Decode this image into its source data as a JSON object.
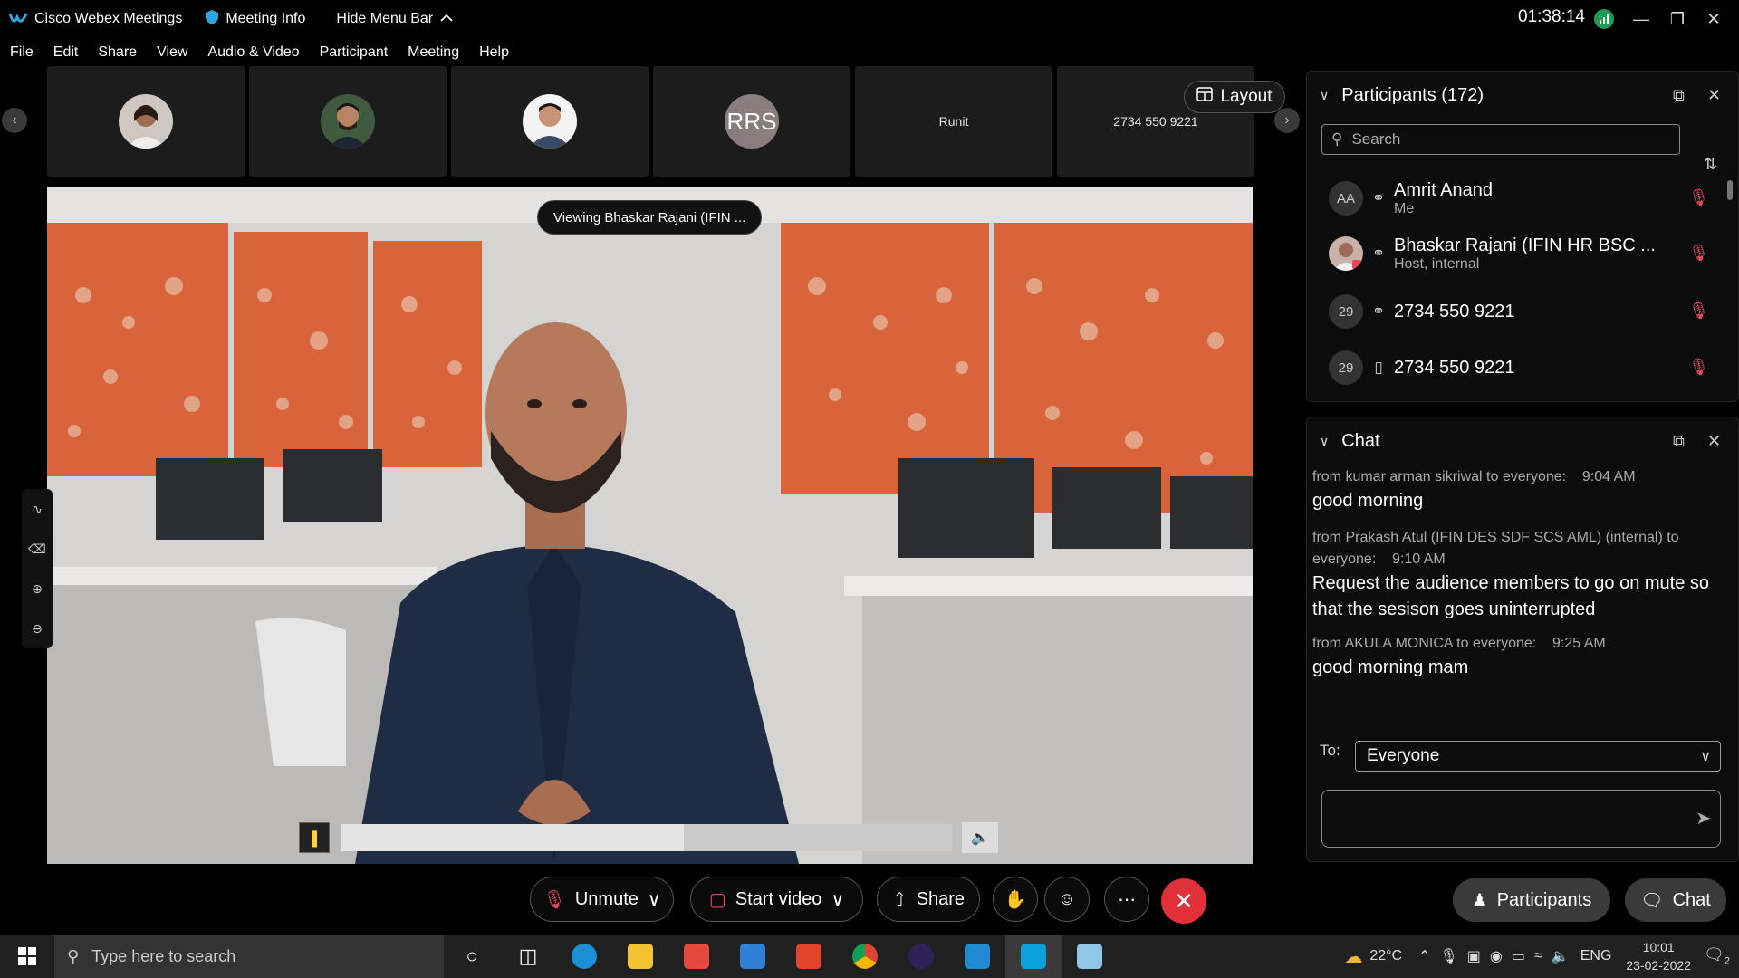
{
  "window": {
    "app_title": "Cisco Webex Meetings",
    "meeting_info": "Meeting Info",
    "hide_menu": "Hide Menu Bar",
    "timer": "01:38:14"
  },
  "menu": [
    "File",
    "Edit",
    "Share",
    "View",
    "Audio & Video",
    "Participant",
    "Meeting",
    "Help"
  ],
  "thumbnails": [
    {
      "type": "photo"
    },
    {
      "type": "photo"
    },
    {
      "type": "photo"
    },
    {
      "type": "initials",
      "label": "RRS"
    },
    {
      "type": "name",
      "label": "Runit"
    },
    {
      "type": "name",
      "label": "2734 550 9221"
    }
  ],
  "layout_label": "Layout",
  "stage": {
    "viewing_label": "Viewing Bhaskar Rajani (IFIN ...",
    "progress_fraction": 0.56
  },
  "participants": {
    "title": "Participants (172)",
    "search_placeholder": "Search",
    "list": [
      {
        "avatar": "AA",
        "name": "Amrit Anand",
        "sub": "Me",
        "conn": "headset"
      },
      {
        "avatar": "",
        "name": "Bhaskar Rajani (IFIN HR BSC ...",
        "sub": "Host, internal",
        "conn": "headset"
      },
      {
        "avatar": "29",
        "name": "2734 550 9221",
        "sub": "",
        "conn": "headset"
      },
      {
        "avatar": "29",
        "name": "2734 550 9221",
        "sub": "",
        "conn": "phone"
      }
    ]
  },
  "chat": {
    "title": "Chat",
    "messages": [
      {
        "meta": "from kumar arman sikriwal to everyone:    9:04 AM",
        "text": "good morning"
      },
      {
        "meta": "from Prakash Atul (IFIN DES SDF SCS AML) (internal) to everyone:    9:10 AM",
        "text": "Request the audience members to go on mute so that the sesison goes uninterrupted"
      },
      {
        "meta": "from AKULA MONICA to everyone:    9:25 AM",
        "text": "good morning mam"
      }
    ],
    "to_label": "To:",
    "to_value": "Everyone"
  },
  "controls": {
    "unmute": "Unmute",
    "start_video": "Start video",
    "share": "Share",
    "participants": "Participants",
    "chat": "Chat"
  },
  "taskbar": {
    "search_placeholder": "Type here to search",
    "weather": "22°C",
    "lang": "ENG",
    "time": "10:01",
    "date": "23-02-2022",
    "notifications": "2"
  },
  "colors": {
    "mute_red": "#e8475a",
    "end_red": "#e0313a",
    "wall_orange": "#d9633a"
  }
}
